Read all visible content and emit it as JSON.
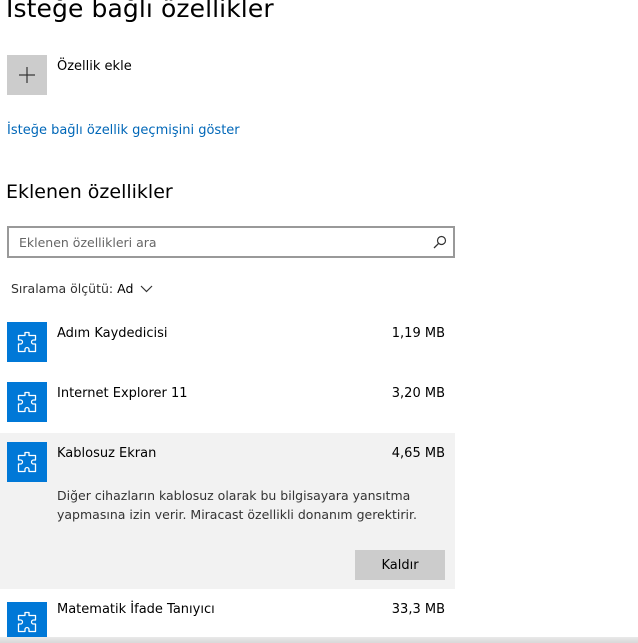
{
  "page": {
    "title": "İsteğe bağlı özellikler"
  },
  "add_feature": {
    "label": "Özellik ekle",
    "icon": "plus-icon"
  },
  "history_link": {
    "label": "İsteğe bağlı özellik geçmişini göster"
  },
  "installed": {
    "title": "Eklenen özellikler",
    "search_placeholder": "Eklenen özellikleri ara",
    "search_icon": "search-icon",
    "sort_label": "Sıralama ölçütü:",
    "sort_value": "Ad",
    "sort_icon": "chevron-down-icon",
    "items": [
      {
        "name": "Adım Kaydedicisi",
        "size": "1,19 MB",
        "icon": "puzzle-icon"
      },
      {
        "name": "Internet Explorer 11",
        "size": "3,20 MB",
        "icon": "puzzle-icon"
      },
      {
        "name": "Kablosuz Ekran",
        "size": "4,65 MB",
        "icon": "puzzle-icon",
        "description": "Diğer cihazların kablosuz olarak bu bilgisayara yansıtma yapmasına izin verir. Miracast özellikli donanım gerektirir.",
        "remove_label": "Kaldır"
      },
      {
        "name": "Matematik İfade Tanıyıcı",
        "size": "33,3 MB",
        "icon": "puzzle-icon"
      }
    ]
  },
  "colors": {
    "accent": "#0078d7",
    "link": "#0067b8",
    "selected_bg": "#f2f2f2",
    "button_bg": "#cccccc"
  }
}
